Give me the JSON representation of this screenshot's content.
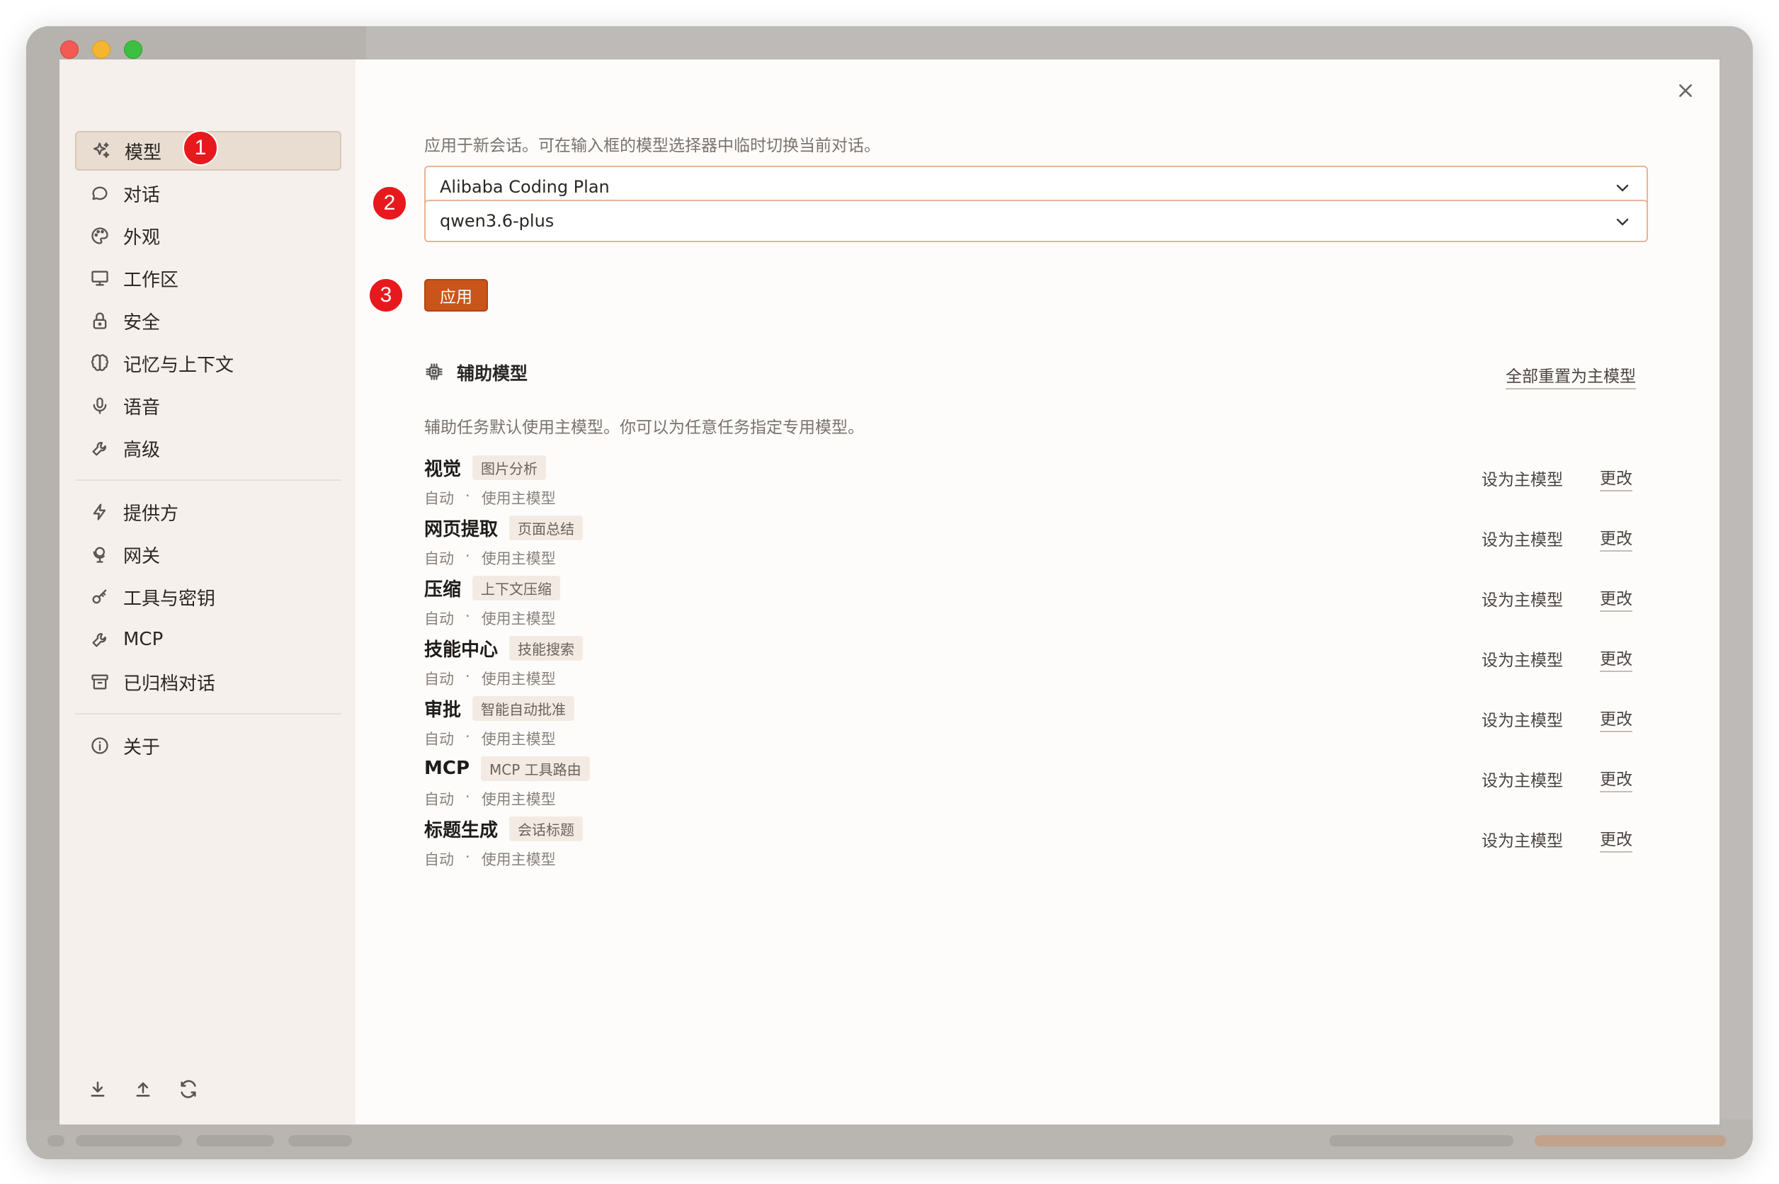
{
  "sidebar": {
    "group1": [
      {
        "label": "模型",
        "icon": "sparkle-icon",
        "active": true
      },
      {
        "label": "对话",
        "icon": "chat-bubble-icon"
      },
      {
        "label": "外观",
        "icon": "palette-icon"
      },
      {
        "label": "工作区",
        "icon": "monitor-icon"
      },
      {
        "label": "安全",
        "icon": "lock-icon"
      },
      {
        "label": "记忆与上下文",
        "icon": "brain-icon"
      },
      {
        "label": "语音",
        "icon": "microphone-icon"
      },
      {
        "label": "高级",
        "icon": "wrench-icon"
      }
    ],
    "group2": [
      {
        "label": "提供方",
        "icon": "lightning-icon"
      },
      {
        "label": "网关",
        "icon": "globe-stand-icon"
      },
      {
        "label": "工具与密钥",
        "icon": "key-icon"
      },
      {
        "label": "MCP",
        "icon": "wrench-icon"
      },
      {
        "label": "已归档对话",
        "icon": "archive-icon"
      }
    ],
    "group3": [
      {
        "label": "关于",
        "icon": "info-icon"
      }
    ],
    "footer_icons": [
      "download-icon",
      "upload-icon",
      "refresh-icon"
    ]
  },
  "badges": [
    "1",
    "2",
    "3"
  ],
  "main": {
    "hint": "应用于新会话。可在输入框的模型选择器中临时切换当前对话。",
    "provider_select": "Alibaba Coding Plan",
    "model_select": "qwen3.6-plus",
    "apply_label": "应用",
    "aux_section": {
      "title": "辅助模型",
      "reset_all": "全部重置为主模型",
      "description": "辅助任务默认使用主模型。你可以为任意任务指定专用模型。",
      "tasks": [
        {
          "name": "视觉",
          "tag": "图片分析",
          "mode": "自动",
          "sep": "·",
          "model": "使用主模型",
          "set_main": "设为主模型",
          "change": "更改"
        },
        {
          "name": "网页提取",
          "tag": "页面总结",
          "mode": "自动",
          "sep": "·",
          "model": "使用主模型",
          "set_main": "设为主模型",
          "change": "更改"
        },
        {
          "name": "压缩",
          "tag": "上下文压缩",
          "mode": "自动",
          "sep": "·",
          "model": "使用主模型",
          "set_main": "设为主模型",
          "change": "更改"
        },
        {
          "name": "技能中心",
          "tag": "技能搜索",
          "mode": "自动",
          "sep": "·",
          "model": "使用主模型",
          "set_main": "设为主模型",
          "change": "更改"
        },
        {
          "name": "审批",
          "tag": "智能自动批准",
          "mode": "自动",
          "sep": "·",
          "model": "使用主模型",
          "set_main": "设为主模型",
          "change": "更改"
        },
        {
          "name": "MCP",
          "tag": "MCP 工具路由",
          "mode": "自动",
          "sep": "·",
          "model": "使用主模型",
          "set_main": "设为主模型",
          "change": "更改"
        },
        {
          "name": "标题生成",
          "tag": "会话标题",
          "mode": "自动",
          "sep": "·",
          "model": "使用主模型",
          "set_main": "设为主模型",
          "change": "更改"
        }
      ]
    }
  },
  "colors": {
    "accent": "#c9551a",
    "badge_red": "#e8191d",
    "sidebar_bg": "#f5f0eb",
    "active_item_bg": "#e9ddd2",
    "select_border": "#e5b59a"
  }
}
